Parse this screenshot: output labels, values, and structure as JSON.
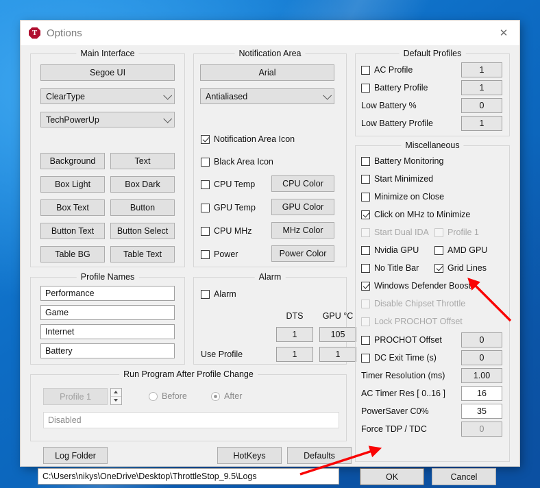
{
  "window": {
    "title": "Options",
    "icon": "throttlestop-logo-icon",
    "icon_letter": "T",
    "close_label": "✕",
    "accent_red": "#b01030",
    "annotation_color": "#f90505"
  },
  "main_interface": {
    "legend": "Main Interface",
    "font_button": "Segoe UI",
    "rendering": "ClearType",
    "theme": "TechPowerUp",
    "color_buttons": [
      "Background",
      "Text",
      "Box Light",
      "Box Dark",
      "Box Text",
      "Button",
      "Button Text",
      "Button Select",
      "Table BG",
      "Table Text"
    ]
  },
  "profile_names": {
    "legend": "Profile Names",
    "values": [
      "Performance",
      "Game",
      "Internet",
      "Battery"
    ]
  },
  "notification_area": {
    "legend": "Notification Area",
    "font_button": "Arial",
    "rendering": "Antialiased",
    "checkboxes": [
      {
        "label": "Notification Area Icon",
        "checked": true,
        "enabled": true
      },
      {
        "label": "Black Area Icon",
        "checked": false,
        "enabled": true
      },
      {
        "label": "CPU Temp",
        "checked": false,
        "enabled": true
      },
      {
        "label": "GPU Temp",
        "checked": false,
        "enabled": true
      },
      {
        "label": "CPU MHz",
        "checked": false,
        "enabled": true
      },
      {
        "label": "Power",
        "checked": false,
        "enabled": true
      }
    ],
    "color_buttons": [
      "CPU Color",
      "GPU Color",
      "MHz Color",
      "Power Color"
    ]
  },
  "alarm": {
    "legend": "Alarm",
    "enable_label": "Alarm",
    "enabled": false,
    "col_dts": "DTS",
    "col_gpu": "GPU °C",
    "use_profile_label": "Use Profile",
    "dts_value": "1",
    "gpu_value": "105",
    "dts_profile": "1",
    "gpu_profile": "1"
  },
  "default_profiles": {
    "legend": "Default Profiles",
    "rows": [
      {
        "label": "AC Profile",
        "type": "checkbox",
        "checked": false,
        "value": "1"
      },
      {
        "label": "Battery Profile",
        "type": "checkbox",
        "checked": false,
        "value": "1"
      },
      {
        "label": "Low Battery %",
        "type": "label",
        "value": "0"
      },
      {
        "label": "Low Battery Profile",
        "type": "label",
        "value": "1"
      }
    ]
  },
  "miscellaneous": {
    "legend": "Miscellaneous",
    "checkboxes": [
      {
        "label": "Battery Monitoring",
        "checked": false,
        "enabled": true
      },
      {
        "label": "Start Minimized",
        "checked": false,
        "enabled": true
      },
      {
        "label": "Minimize on Close",
        "checked": false,
        "enabled": true
      },
      {
        "label": "Click on MHz to Minimize",
        "checked": true,
        "enabled": true
      },
      {
        "label": "Start Dual IDA",
        "checked": false,
        "enabled": false
      },
      {
        "label": "Profile 1",
        "checked": false,
        "enabled": false
      },
      {
        "label": "Nvidia GPU",
        "checked": false,
        "enabled": true
      },
      {
        "label": "AMD GPU",
        "checked": false,
        "enabled": true
      },
      {
        "label": "No Title Bar",
        "checked": false,
        "enabled": true
      },
      {
        "label": "Grid Lines",
        "checked": true,
        "enabled": true
      },
      {
        "label": "Windows Defender Boost",
        "checked": true,
        "enabled": true
      },
      {
        "label": "Disable Chipset Throttle",
        "checked": false,
        "enabled": false
      },
      {
        "label": "Lock PROCHOT Offset",
        "checked": false,
        "enabled": false
      },
      {
        "label": "PROCHOT Offset",
        "checked": false,
        "enabled": true
      },
      {
        "label": "DC Exit Time (s)",
        "checked": false,
        "enabled": true
      }
    ],
    "value_rows": [
      {
        "label": "PROCHOT Offset",
        "value": "0",
        "editable": false
      },
      {
        "label": "DC Exit Time (s)",
        "value": "0",
        "editable": false
      },
      {
        "label": "Timer Resolution (ms)",
        "value": "1.00",
        "editable": false
      },
      {
        "label": "AC Timer Res [ 0..16 ]",
        "value": "16",
        "editable": true
      },
      {
        "label": "PowerSaver C0%",
        "value": "35",
        "editable": true
      },
      {
        "label": "Force TDP / TDC",
        "value": "0",
        "editable": false
      }
    ]
  },
  "run_program": {
    "legend": "Run Program After Profile Change",
    "profile_button": "Profile 1",
    "radio_before": "Before",
    "radio_after": "After",
    "selected": "After",
    "program_value": "Disabled"
  },
  "bottom": {
    "log_folder": "Log Folder",
    "hotkeys": "HotKeys",
    "defaults": "Defaults",
    "log_path": "C:\\Users\\nikys\\OneDrive\\Desktop\\ThrottleStop_9.5\\Logs",
    "ok": "OK",
    "cancel": "Cancel"
  }
}
